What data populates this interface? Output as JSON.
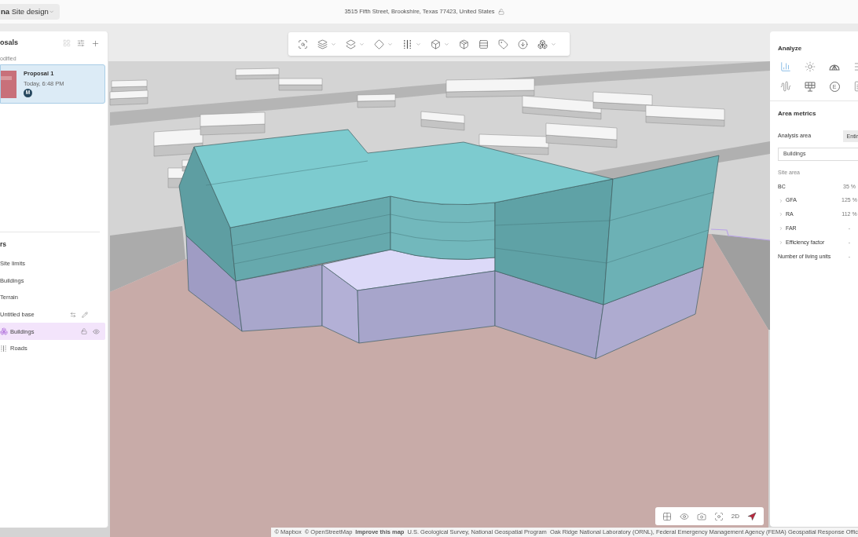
{
  "header": {
    "title": "**na** Site design",
    "address": "3515 Fifth Street, Brookshire, Texas 77423, United States"
  },
  "proposals": {
    "title": "osals",
    "group_label": "odified",
    "items": [
      {
        "name": "Proposal 1",
        "time": "Today, 6:48 PM",
        "author": "M",
        "selected": true
      }
    ]
  },
  "layers": {
    "title": "rs",
    "items": [
      {
        "name": "Site limits",
        "kind": "plain",
        "selected": false
      },
      {
        "name": "Buildings",
        "kind": "plain",
        "selected": false
      },
      {
        "name": "Terrain",
        "kind": "plain",
        "selected": false
      },
      {
        "name": "Untitled base",
        "kind": "base",
        "selected": false,
        "children": [
          {
            "name": "Buildings",
            "kind": "buildings",
            "selected": true
          },
          {
            "name": "Roads",
            "kind": "roads",
            "selected": false
          }
        ]
      }
    ]
  },
  "map_toolbar": [
    {
      "kind": "scan",
      "dropdown": false
    },
    {
      "kind": "stack",
      "dropdown": true
    },
    {
      "kind": "layers",
      "dropdown": true
    },
    {
      "kind": "diamond",
      "dropdown": true
    },
    {
      "kind": "dashed",
      "dropdown": true
    },
    {
      "kind": "cube",
      "dropdown": true
    },
    {
      "kind": "package",
      "dropdown": false
    },
    {
      "kind": "rows",
      "dropdown": false
    },
    {
      "kind": "tag",
      "dropdown": false
    },
    {
      "kind": "download",
      "dropdown": false
    },
    {
      "kind": "boxes",
      "dropdown": true
    }
  ],
  "analyze": {
    "title": "Analyze",
    "tools": [
      {
        "kind": "bars",
        "selected": true
      },
      {
        "kind": "sun",
        "selected": false
      },
      {
        "kind": "dome",
        "selected": false
      },
      {
        "kind": "list",
        "selected": false
      },
      {
        "kind": "wave",
        "selected": false
      },
      {
        "kind": "solar",
        "selected": false
      },
      {
        "kind": "letter",
        "glyph": "E",
        "selected": false
      },
      {
        "kind": "doc",
        "selected": false
      }
    ]
  },
  "area_metrics": {
    "title": "Area metrics",
    "analysis_area_label": "Analysis area",
    "analysis_area_option": "Entir",
    "layer": "Buildings",
    "section": "Site area",
    "rows": [
      {
        "label": "BC",
        "value": "35 %",
        "expandable": false
      },
      {
        "label": "GFA",
        "value": "125 %",
        "expandable": true
      },
      {
        "label": "RA",
        "value": "112 %",
        "expandable": true
      },
      {
        "label": "FAR",
        "value": "-",
        "expandable": true
      },
      {
        "label": "Efficiency factor",
        "value": "-",
        "expandable": true
      },
      {
        "label": "Number of living units",
        "value": "-",
        "expandable": false
      }
    ]
  },
  "view_controls": [
    {
      "kind": "grid"
    },
    {
      "kind": "eye"
    },
    {
      "kind": "camera"
    },
    {
      "kind": "focus"
    },
    {
      "kind": "label",
      "label": "2D"
    },
    {
      "kind": "compass"
    }
  ],
  "attribution": [
    {
      "kind": "link",
      "text": "© Mapbox"
    },
    {
      "kind": "link",
      "text": "© OpenStreetMap"
    },
    {
      "kind": "strong_link",
      "text": "Improve this map"
    },
    {
      "kind": "text",
      "text": "U.S. Geological Survey, National Geospatial Program"
    },
    {
      "kind": "text",
      "text": "Oak Ridge National Laboratory (ORNL), Federal Emergency Management Agency (FEMA) Geospatial Response Offic"
    }
  ]
}
